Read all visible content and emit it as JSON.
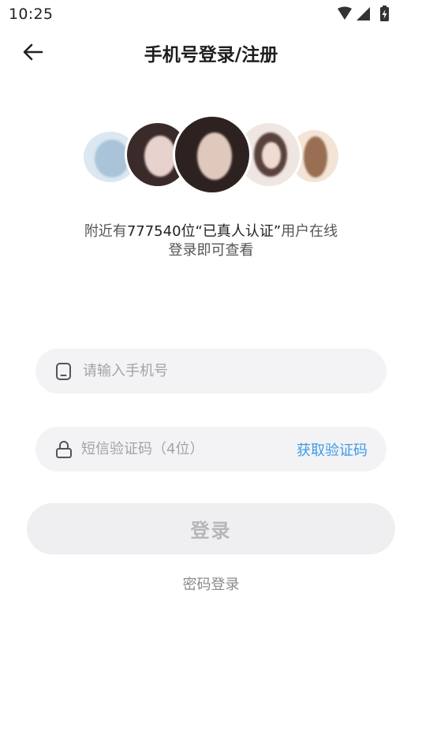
{
  "status_bar": {
    "time": "10:25",
    "icons": [
      "wifi-icon",
      "cellular-signal-icon",
      "battery-charging-icon"
    ]
  },
  "header": {
    "back_icon": "arrow-left-icon",
    "title": "手机号登录/注册"
  },
  "hero": {
    "line_prefix": "附近有",
    "line_strong": "777540位“已真人认证”",
    "line_suffix": "用户在线",
    "subline": "登录即可查看",
    "avatars": [
      {
        "name": "avatar-1",
        "colors": [
          "#cfe3ef",
          "#9fbcd4"
        ]
      },
      {
        "name": "avatar-2",
        "colors": [
          "#e7d3cf",
          "#3a2b2a"
        ]
      },
      {
        "name": "avatar-3",
        "colors": [
          "#e3cfc4",
          "#2e2220"
        ]
      },
      {
        "name": "avatar-4",
        "colors": [
          "#efe2dc",
          "#5a423c"
        ]
      },
      {
        "name": "avatar-5",
        "colors": [
          "#f0dccb",
          "#9a6e52"
        ]
      }
    ]
  },
  "form": {
    "phone_icon": "phone-icon",
    "phone_placeholder": "请输入手机号",
    "phone_value": "",
    "code_icon": "lock-icon",
    "code_placeholder": "短信验证码（4位）",
    "code_value": "",
    "get_code_label": "获取验证码",
    "accent_color": "#3d9be9"
  },
  "actions": {
    "login_label": "登录",
    "password_login_label": "密码登录"
  }
}
